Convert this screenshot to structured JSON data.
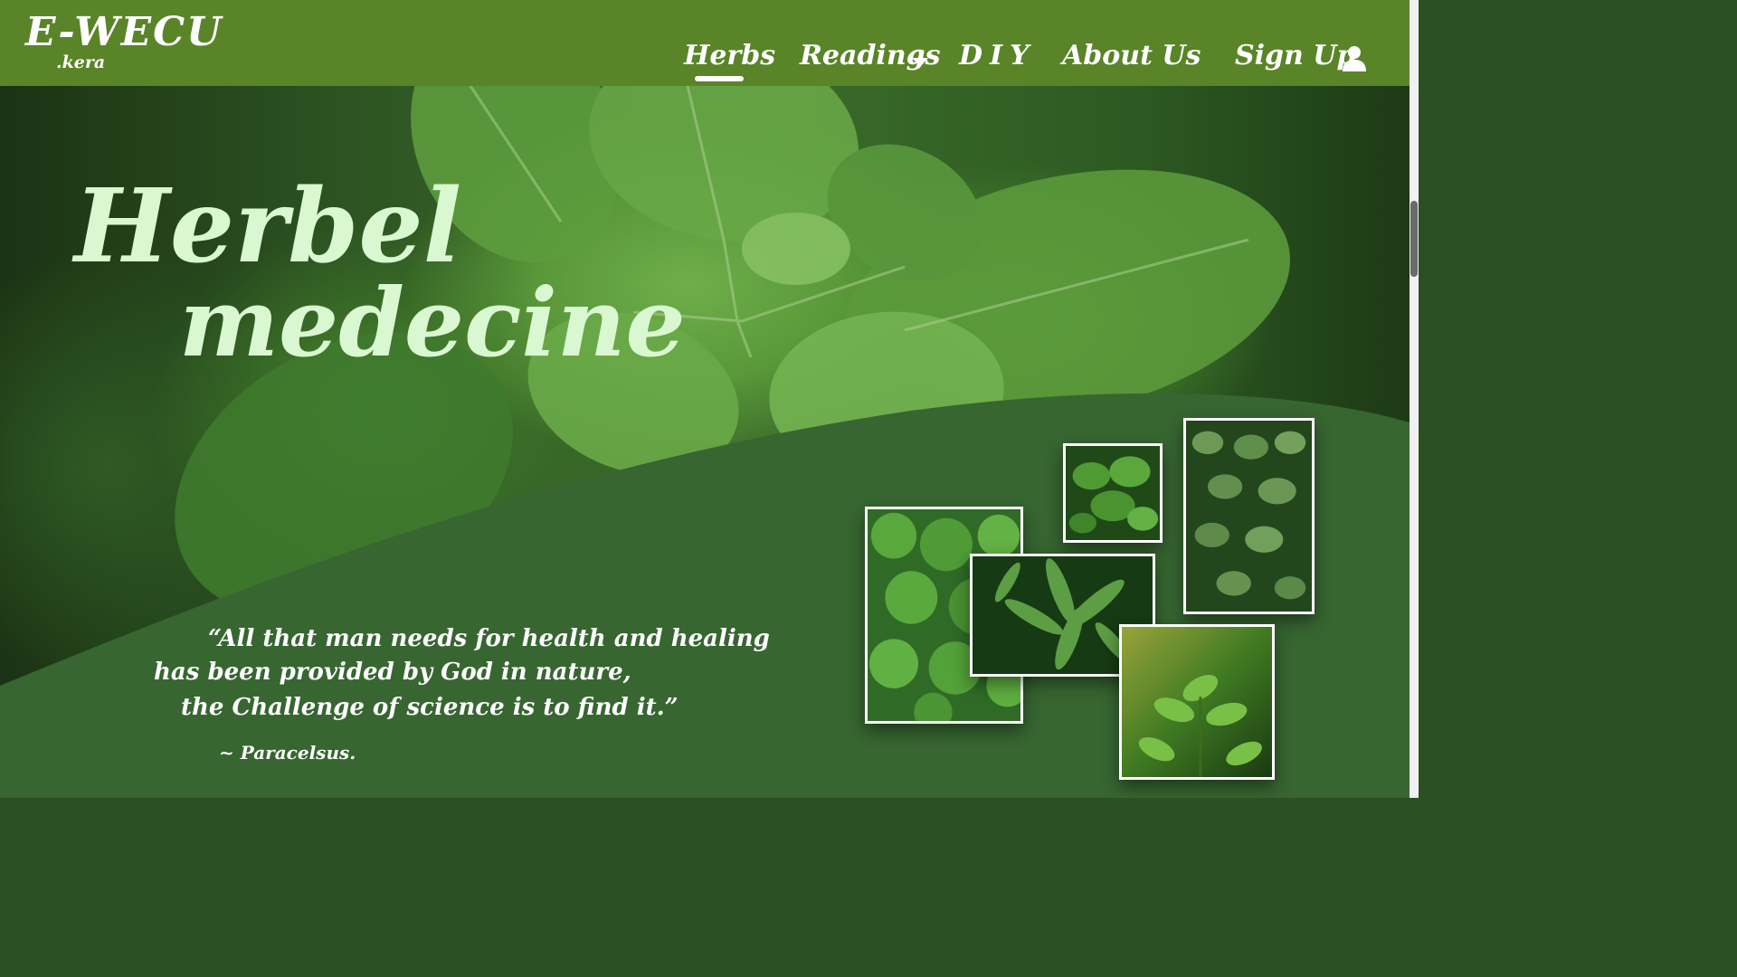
{
  "logo": {
    "main": "E-WECU",
    "sub": ".kera"
  },
  "nav": {
    "herbs": "Herbs",
    "readings": "Readings",
    "diy": "DIY",
    "about": "About Us",
    "signup": "Sign Up"
  },
  "hero": {
    "title_line1": "Herbel",
    "title_line2": "medecine"
  },
  "quote": {
    "line1": "“All that man needs for health and healing",
    "line2": "has been provided by God in nature,",
    "line3": "the Challenge of science is to find it.”",
    "author": "~ Paracelsus."
  },
  "colors": {
    "nav_bg": "#5a8428",
    "wave_bg": "#376631",
    "title_text": "#d9f7d1"
  }
}
